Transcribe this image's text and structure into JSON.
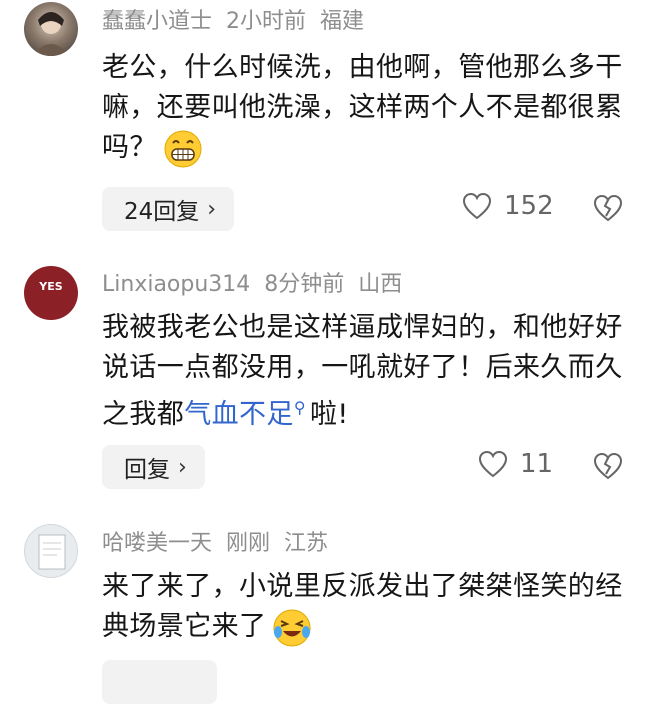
{
  "comments": [
    {
      "username": "蠢蠢小道士",
      "time": "2小时前",
      "location": "福建",
      "text": "老公，什么时候洗，由他啊，管他那么多干嘛，还要叫他洗澡，这样两个人不是都很累吗？",
      "emoji": "grin-emoji",
      "reply_label": "24回复",
      "likes": "152"
    },
    {
      "username": "Linxiaopu314",
      "time": "8分钟前",
      "location": "山西",
      "avatar_text": "YES",
      "text_before": "我被我老公也是这样逼成悍妇的，和他好好说话一点都没用，一吼就好了！后来久而久之我都",
      "link_text": "气血不足",
      "text_after": "啦!",
      "reply_label": "回复",
      "likes": "11"
    },
    {
      "username": "哈喽美一天",
      "time": "刚刚",
      "location": "江苏",
      "text": "来了来了，小说里反派发出了桀桀怪笑的经典场景它来了",
      "emoji": "crying-laughing-emoji"
    }
  ],
  "colors": {
    "meta": "#8e8e8e",
    "link": "#3366cc",
    "reply_bg": "#f2f2f2"
  }
}
